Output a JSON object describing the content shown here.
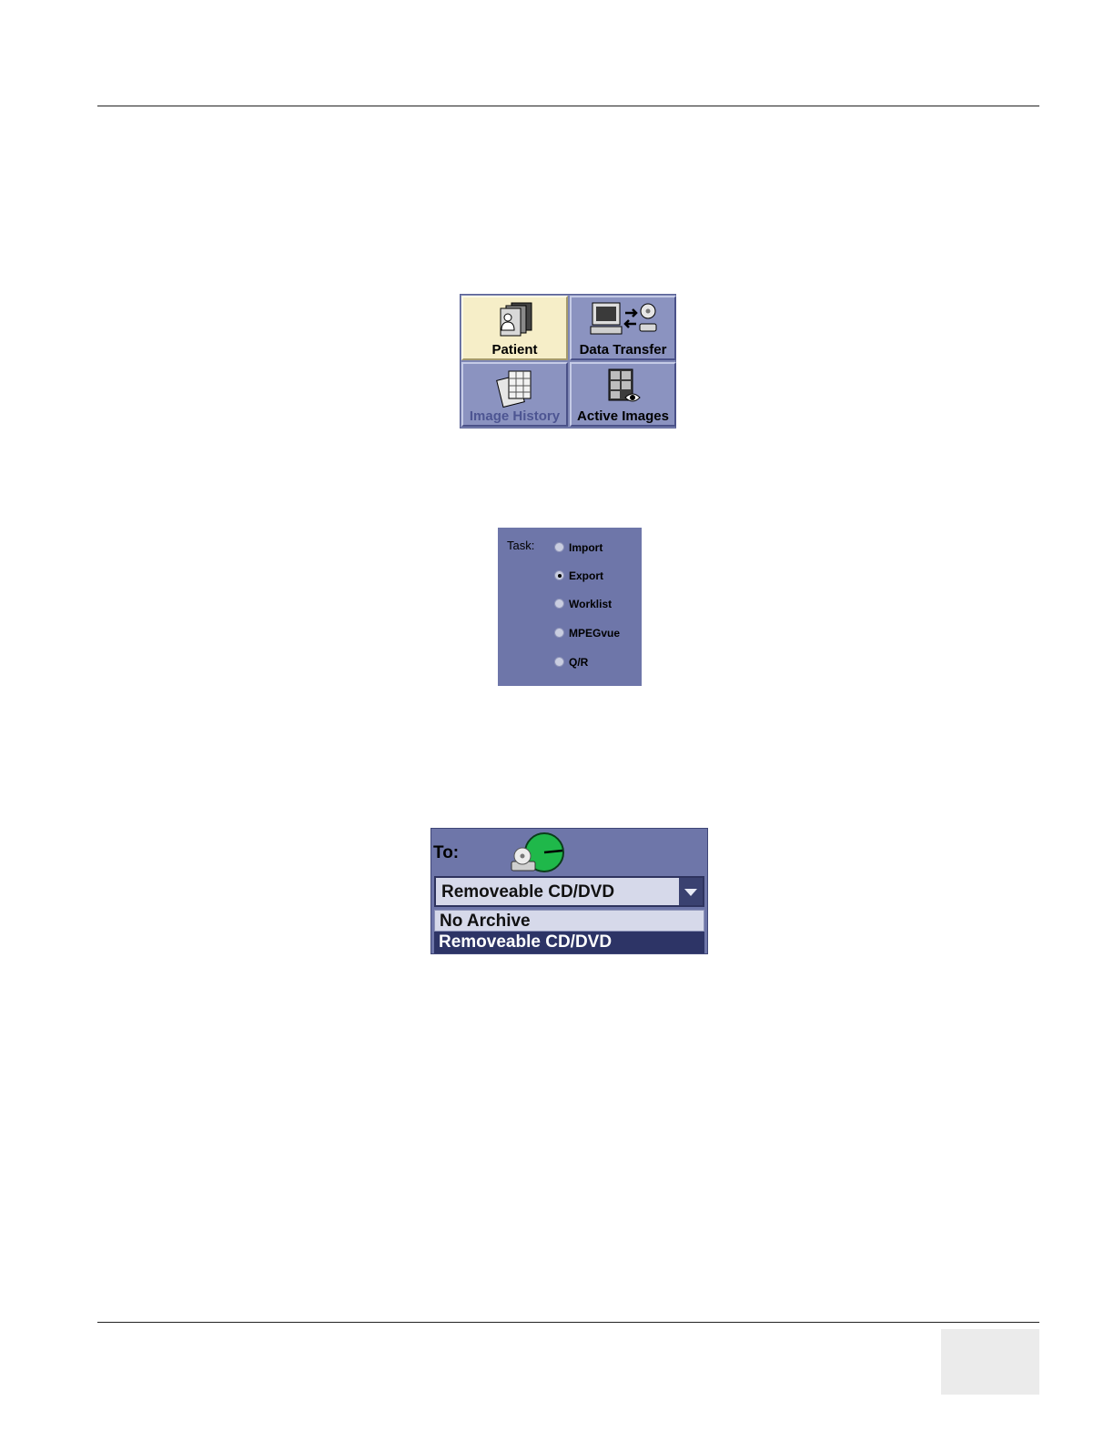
{
  "tabs": {
    "patient": "Patient",
    "data_transfer": "Data Transfer",
    "image_history": "Image History",
    "active_images": "Active Images",
    "icons": [
      "patient-folder-icon",
      "data-transfer-icon",
      "image-history-icon",
      "active-images-icon"
    ]
  },
  "task": {
    "label": "Task:",
    "options": [
      {
        "label": "Import",
        "checked": false
      },
      {
        "label": "Export",
        "checked": true
      },
      {
        "label": "Worklist",
        "checked": false
      },
      {
        "label": "MPEGvue",
        "checked": false
      },
      {
        "label": "Q/R",
        "checked": false
      }
    ]
  },
  "destination": {
    "label": "To:",
    "selected": "Removeable CD/DVD",
    "options": [
      "No Archive",
      "Removeable CD/DVD"
    ],
    "highlighted": "Removeable CD/DVD"
  },
  "colors": {
    "panel": "#6e76a9",
    "tab_active": "#f6eec8",
    "tab": "#8b93c0",
    "highlight": "#2d3466",
    "status_green": "#1fb84a"
  }
}
